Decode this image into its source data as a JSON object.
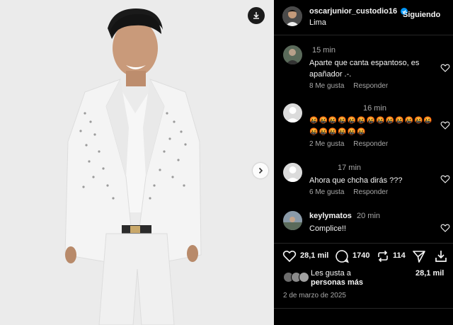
{
  "colors": {
    "background": "#000000",
    "text": "#f5f5f5",
    "muted": "#a8a8a8",
    "verified": "#0095f6",
    "divider": "#262626"
  },
  "media": {
    "download_icon": "download-icon",
    "next_icon": "chevron-right-icon"
  },
  "header": {
    "username": "oscarjunior_custodio16",
    "location": "Lima",
    "follow_state": "Siguiendo",
    "verified_icon": "verified-badge-icon"
  },
  "comments": [
    {
      "author": "",
      "time": "15 min",
      "text": "Aparte que canta espantoso, es apañador .-.",
      "likes": "8 Me gusta",
      "reply": "Responder"
    },
    {
      "author": "",
      "time": "16 min",
      "text": "🤬🤬🤬🤬🤬🤬🤬🤬🤬🤬🤬🤬🤬🤬🤬🤬🤬🤬🤬",
      "likes": "2 Me gusta",
      "reply": "Responder"
    },
    {
      "author": "",
      "time": "17 min",
      "text": "Ahora que chcha dirás ???",
      "likes": "6 Me gusta",
      "reply": "Responder"
    },
    {
      "author": "keylymatos",
      "time": "20 min",
      "text": "Complice!!",
      "likes": "",
      "reply": ""
    }
  ],
  "actions": {
    "like_count": "28,1 mil",
    "comment_count": "1740",
    "repost_count": "114",
    "icons": [
      "heart-icon",
      "comment-icon",
      "repost-icon",
      "share-icon",
      "save-icon"
    ]
  },
  "likes": {
    "liked_by": "Les gusta a",
    "more": "personas más",
    "count": "28,1 mil"
  },
  "date": "2 de marzo de 2025"
}
